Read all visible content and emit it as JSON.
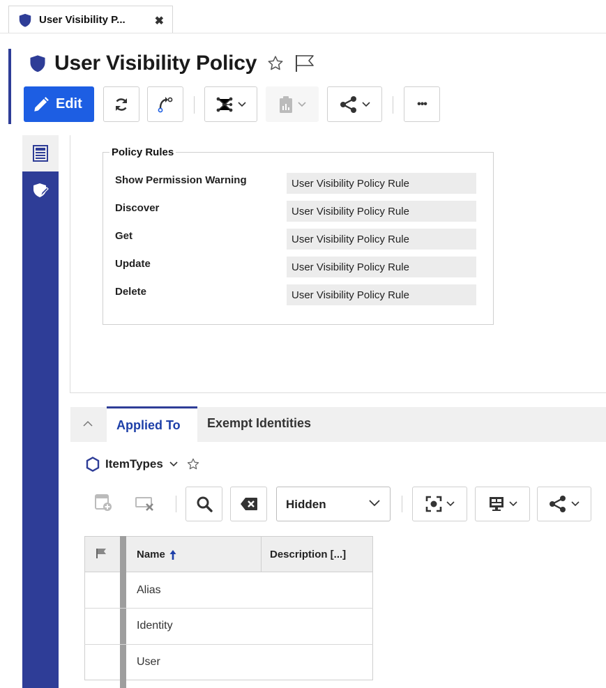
{
  "tab": {
    "title": "User Visibility P...",
    "close_glyph": "✖",
    "icon": "shield-icon"
  },
  "page": {
    "title": "User Visibility Policy",
    "icons": [
      "shield-icon",
      "star-outline-icon",
      "flag-outline-icon"
    ]
  },
  "toolbar": {
    "edit_label": "Edit",
    "buttons": [
      "refresh-icon",
      "promote-icon",
      "structure-icon",
      "report-icon",
      "share-icon",
      "more-icon"
    ],
    "more_glyph": "•••"
  },
  "rail": {
    "items": [
      "form-view-icon",
      "policy-rules-icon"
    ]
  },
  "policy_rules": {
    "legend": "Policy Rules",
    "rows": [
      {
        "label": "Show Permission Warning",
        "value": "User Visibility Policy Rule"
      },
      {
        "label": "Discover",
        "value": "User Visibility Policy Rule"
      },
      {
        "label": "Get",
        "value": "User Visibility Policy Rule"
      },
      {
        "label": "Update",
        "value": "User Visibility Policy Rule"
      },
      {
        "label": "Delete",
        "value": "User Visibility Policy Rule"
      }
    ]
  },
  "relationships": {
    "tabs": [
      "Applied To",
      "Exempt Identities"
    ],
    "active_tab": "Applied To",
    "item_type": "ItemTypes",
    "view_select": "Hidden",
    "grid": {
      "columns": [
        "Name",
        "Description [...]"
      ],
      "sort_column": "Name",
      "sort_direction": "ascending",
      "rows": [
        "Alias",
        "Identity",
        "User"
      ]
    }
  },
  "colors": {
    "accent": "#2e3d97",
    "edit_button": "#1d5ee3",
    "active_tab_text": "#1d3fa8",
    "sort_arrow": "#1d3fa8"
  }
}
